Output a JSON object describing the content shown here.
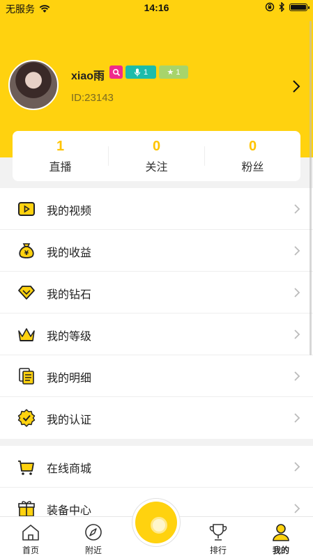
{
  "status_bar": {
    "carrier": "无服务",
    "time": "14:16"
  },
  "profile": {
    "username": "xiao雨",
    "user_id": "ID:23143",
    "badge_teal_level": "1",
    "badge_green_level": "1"
  },
  "stats": [
    {
      "value": "1",
      "label": "直播"
    },
    {
      "value": "0",
      "label": "关注"
    },
    {
      "value": "0",
      "label": "粉丝"
    }
  ],
  "menu": {
    "group1": [
      {
        "label": "我的视频",
        "icon": "video-icon"
      },
      {
        "label": "我的收益",
        "icon": "money-bag-icon"
      },
      {
        "label": "我的钻石",
        "icon": "diamond-icon"
      },
      {
        "label": "我的等级",
        "icon": "crown-icon"
      },
      {
        "label": "我的明细",
        "icon": "document-icon"
      },
      {
        "label": "我的认证",
        "icon": "verified-icon"
      }
    ],
    "group2": [
      {
        "label": "在线商城",
        "icon": "cart-icon"
      },
      {
        "label": "装备中心",
        "icon": "gift-box-icon"
      }
    ]
  },
  "tabbar": [
    {
      "label": "首页",
      "icon": "home-icon"
    },
    {
      "label": "附近",
      "icon": "compass-icon"
    },
    {
      "label": "排行",
      "icon": "trophy-icon"
    },
    {
      "label": "我的",
      "icon": "person-icon"
    }
  ],
  "colors": {
    "accent": "#ffd20f",
    "stat_number": "#ffc400"
  }
}
